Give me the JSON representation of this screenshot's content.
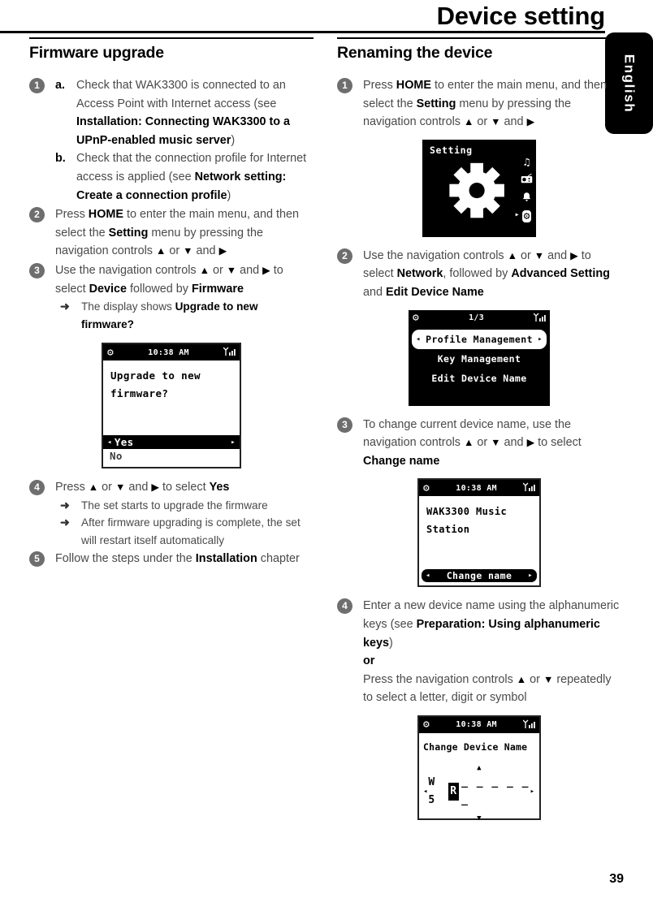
{
  "header": {
    "title": "Device setting",
    "language_tab": "English"
  },
  "left_column": {
    "heading": "Firmware upgrade",
    "steps": [
      {
        "num": "1",
        "subs": [
          {
            "marker": "a.",
            "html": "Check that WAK3300 is connected to an Access Point with Internet access (see <b>Installation: Connecting WAK3300 to a UPnP-enabled music server</b>)"
          },
          {
            "marker": "b.",
            "html": "Check that the connection profile for Internet access is applied (see <b>Network setting: Create a connection profile</b>)"
          }
        ]
      },
      {
        "num": "2",
        "html": "Press <b>HOME</b> to enter the main menu, and then select the <b>Setting</b> menu by pressing the navigation controls <span class=\"nav-ico\">▲</span> or <span class=\"nav-ico\">▼</span> and <span class=\"nav-ico\">▶</span>"
      },
      {
        "num": "3",
        "html": "Use the navigation controls <span class=\"nav-ico\">▲</span> or <span class=\"nav-ico\">▼</span> and <span class=\"nav-ico\">▶</span> to select <b>Device</b> followed by <b>Firmware</b>",
        "results": [
          "The display shows <b>Upgrade to new firmware?</b>"
        ]
      },
      {
        "num": "4",
        "html": "Press <span class=\"nav-ico\">▲</span> or <span class=\"nav-ico\">▼</span> and <span class=\"nav-ico\">▶</span> to select <b>Yes</b>",
        "results": [
          "The set starts to upgrade the firmware",
          "After firmware upgrading is complete, the set will restart itself automatically"
        ]
      },
      {
        "num": "5",
        "html": "Follow the steps under the <b>Installation</b> chapter"
      }
    ],
    "lcd_firmware": {
      "status_time": "10:38 AM",
      "line1": "Upgrade to new",
      "line2": "firmware?",
      "option_yes": "Yes",
      "option_no": "No",
      "left_caret": "◂",
      "right_caret": "▸"
    }
  },
  "right_column": {
    "heading": "Renaming the device",
    "steps": [
      {
        "num": "1",
        "html": "Press <b>HOME</b> to enter the main menu, and then select the <b>Setting</b> menu by pressing the navigation controls <span class=\"nav-ico\">▲</span> or <span class=\"nav-ico\">▼</span> and <span class=\"nav-ico\">▶</span>"
      },
      {
        "num": "2",
        "html": "Use the navigation controls <span class=\"nav-ico\">▲</span> or <span class=\"nav-ico\">▼</span> and <span class=\"nav-ico\">▶</span> to select <b>Network</b>, followed by <b>Advanced Setting</b> and <b>Edit Device Name</b>"
      },
      {
        "num": "3",
        "html": "To change current device name, use the navigation controls <span class=\"nav-ico\">▲</span> or <span class=\"nav-ico\">▼</span> and <span class=\"nav-ico\">▶</span> to select <b>Change name</b>"
      },
      {
        "num": "4",
        "html": "Enter a new device name using the alphanumeric keys (see <b>Preparation: Using alphanumeric keys</b>)<br><b>or</b><br>Press the navigation controls <span class=\"nav-ico\">▲</span> or <span class=\"nav-ico\">▼</span> repeatedly to select a letter, digit or symbol"
      }
    ],
    "lcd_setting_home": {
      "title": "Setting",
      "icons": [
        "music-note",
        "radio",
        "bell",
        "gear"
      ],
      "active_icon": "gear"
    },
    "lcd_network_menu": {
      "status_page": "1/3",
      "items": [
        "Profile Management",
        "Key Management",
        "Edit Device Name"
      ],
      "selected": "Profile Management",
      "left_caret": "◂",
      "right_caret": "▸"
    },
    "lcd_device_name": {
      "status_time": "10:38 AM",
      "line1": "WAK3300 Music",
      "line2": "Station",
      "button": "Change name",
      "left_caret": "◂",
      "right_caret": "▸"
    },
    "lcd_change_name": {
      "status_time": "10:38 AM",
      "title": "Change Device Name",
      "chars_before": "W 5",
      "active_char": "R",
      "dashes": "_ _ _ _ _ _",
      "left_caret": "◂",
      "right_caret": "▸",
      "up_arrow": "▲",
      "down_arrow": "▼"
    }
  },
  "footer": {
    "page_number": "39"
  },
  "glyphs": {
    "gear": "⚙",
    "signal": "▖▗",
    "result_arrow": "➜",
    "music_note": "♫",
    "bell": "🔔"
  }
}
